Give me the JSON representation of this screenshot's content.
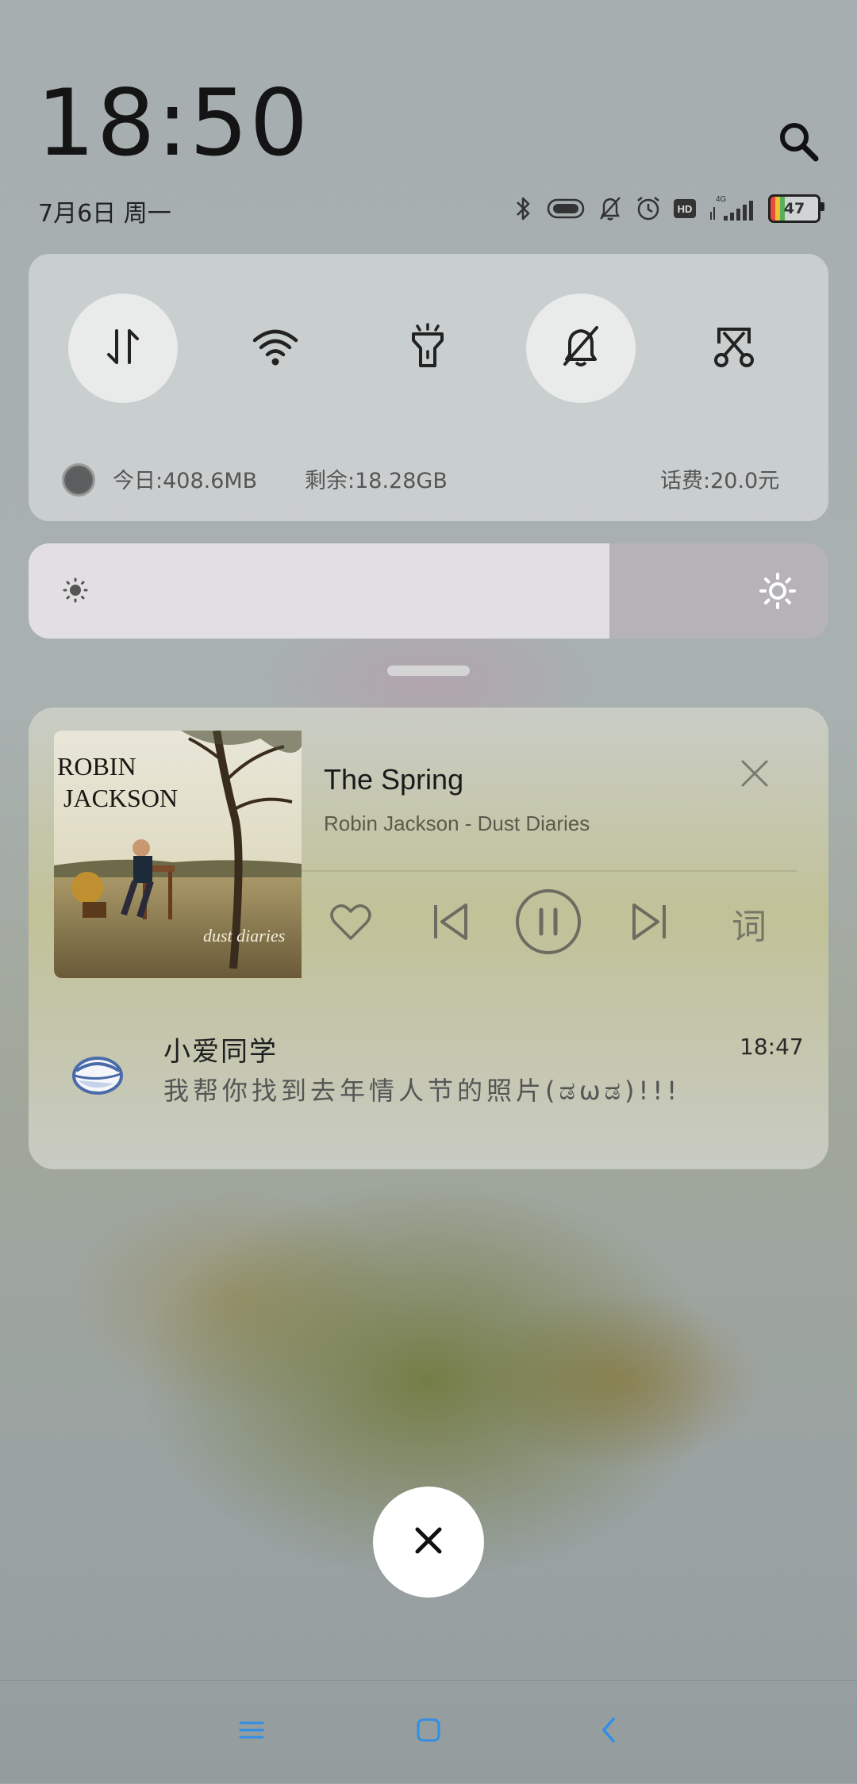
{
  "status": {
    "time": "18:50",
    "date": "7月6日 周一",
    "network": "4G",
    "hd": "HD",
    "battery": "47"
  },
  "quick_toggles": [
    {
      "name": "mobile-data",
      "icon": "data-transfer-icon",
      "on": true
    },
    {
      "name": "wifi",
      "icon": "wifi-icon",
      "on": false
    },
    {
      "name": "flashlight",
      "icon": "flashlight-icon",
      "on": false
    },
    {
      "name": "silent",
      "icon": "bell-off-icon",
      "on": true
    },
    {
      "name": "screenshot",
      "icon": "scissors-icon",
      "on": false
    }
  ],
  "usage": {
    "today": "今日:408.6MB",
    "remaining": "剩余:18.28GB",
    "balance": "话费:20.0元"
  },
  "brightness": {
    "level": 0.726
  },
  "media": {
    "title": "The Spring",
    "subtitle": "Robin Jackson - Dust Diaries",
    "album_text_1": "ROBIN",
    "album_text_2": "JACKSON",
    "album_text_3": "dust diaries",
    "lyrics_label": "词"
  },
  "notification": {
    "app": "小爱同学",
    "time": "18:47",
    "message": "我帮你找到去年情人节的照片(ಡωಡ)!!!"
  },
  "colors": {
    "nav_accent": "#2f8fe6",
    "text_dark": "#141414"
  }
}
